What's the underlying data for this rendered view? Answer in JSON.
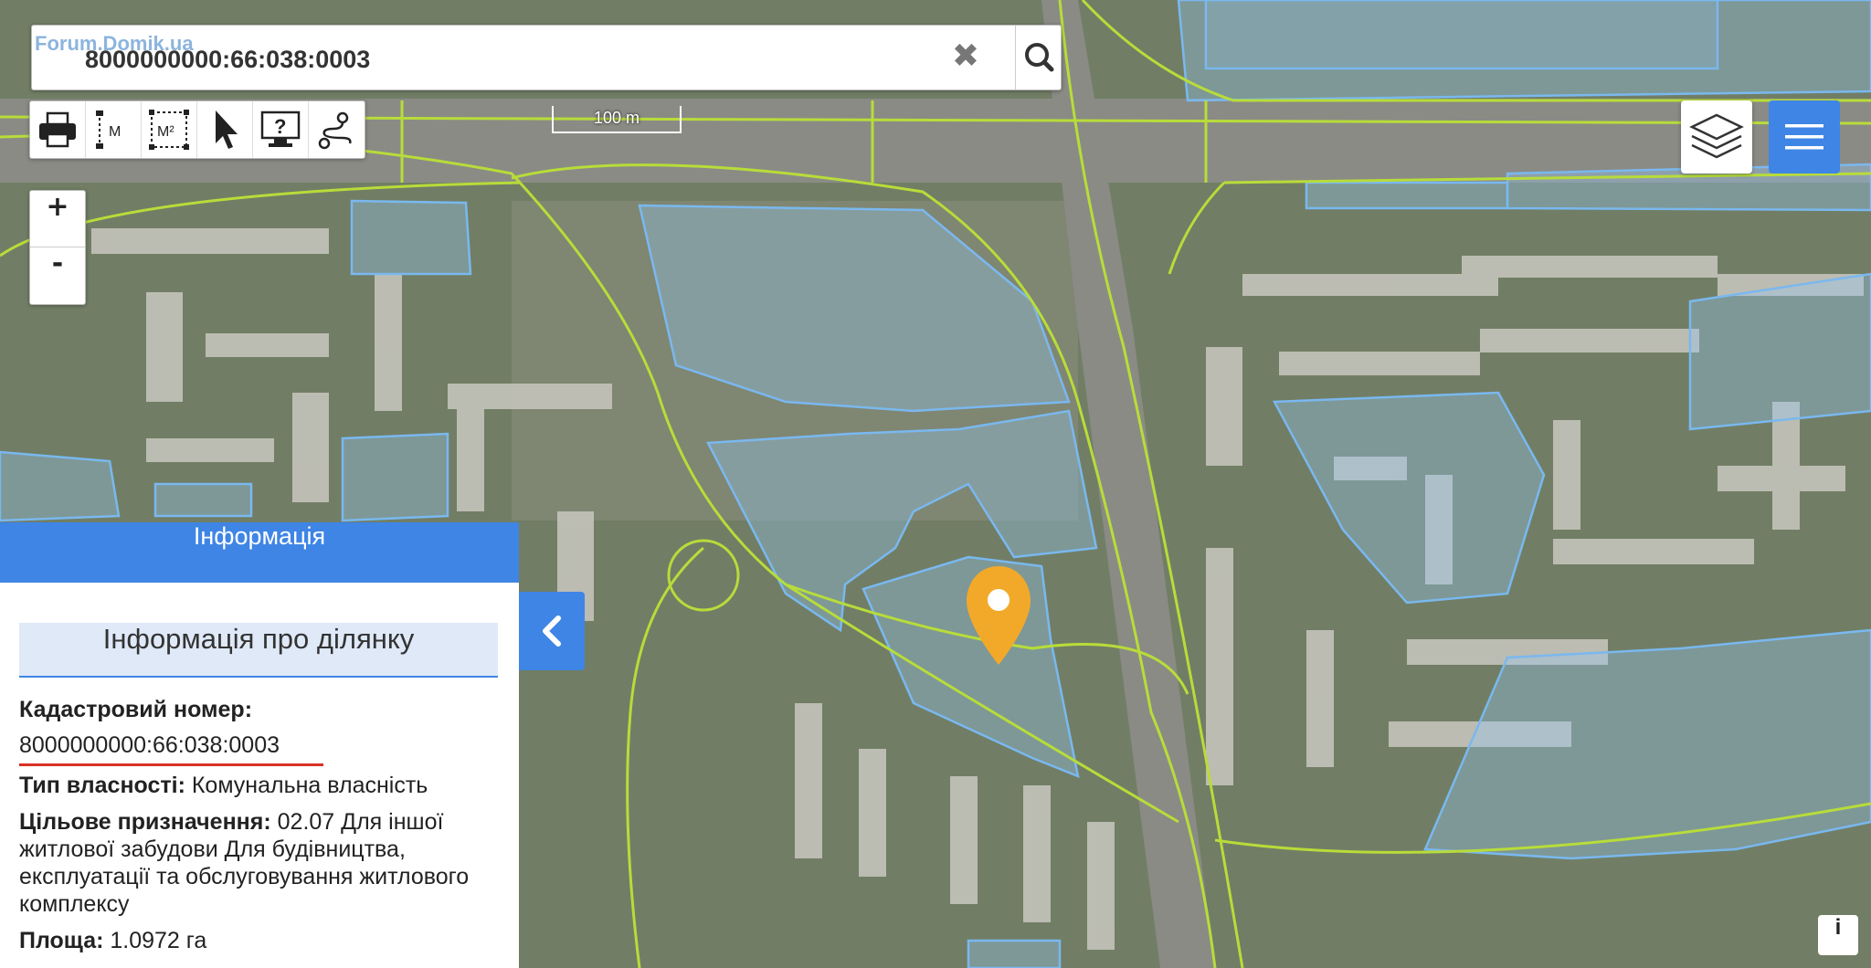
{
  "watermark": "Forum.Domik.ua",
  "search": {
    "value": "8000000000:66:038:0003"
  },
  "scale": {
    "label": "100 m"
  },
  "toolbar": {
    "items": [
      "printer-icon",
      "measure-distance-icon",
      "measure-area-icon",
      "pointer-icon",
      "help-icon",
      "route-icon"
    ],
    "measure_distance_label": "M",
    "measure_area_label": "M²"
  },
  "zoom": {
    "in_label": "+",
    "out_label": "-"
  },
  "panel": {
    "header": "Інформація",
    "subheader": "Інформація про ділянку",
    "cadastral_label": "Кадастровий номер:",
    "cadastral_value": "8000000000:66:038:0003",
    "ownership_label": "Тип власності:",
    "ownership_value": " Комунальна власність",
    "purpose_label": "Цільове призначення:",
    "purpose_value": " 02.07 Для іншої житлової забудови Для будівництва, експлуатації та обслуговування житлового комплексу",
    "area_label": "Площа:",
    "area_value": " 1.0972 га"
  },
  "info_button": "i",
  "colors": {
    "accent": "#3f85e5",
    "parcel_outline": "#7ab8ef",
    "road_line": "#b8dc3a",
    "marker": "#f2a92a",
    "underline": "#d93025"
  }
}
